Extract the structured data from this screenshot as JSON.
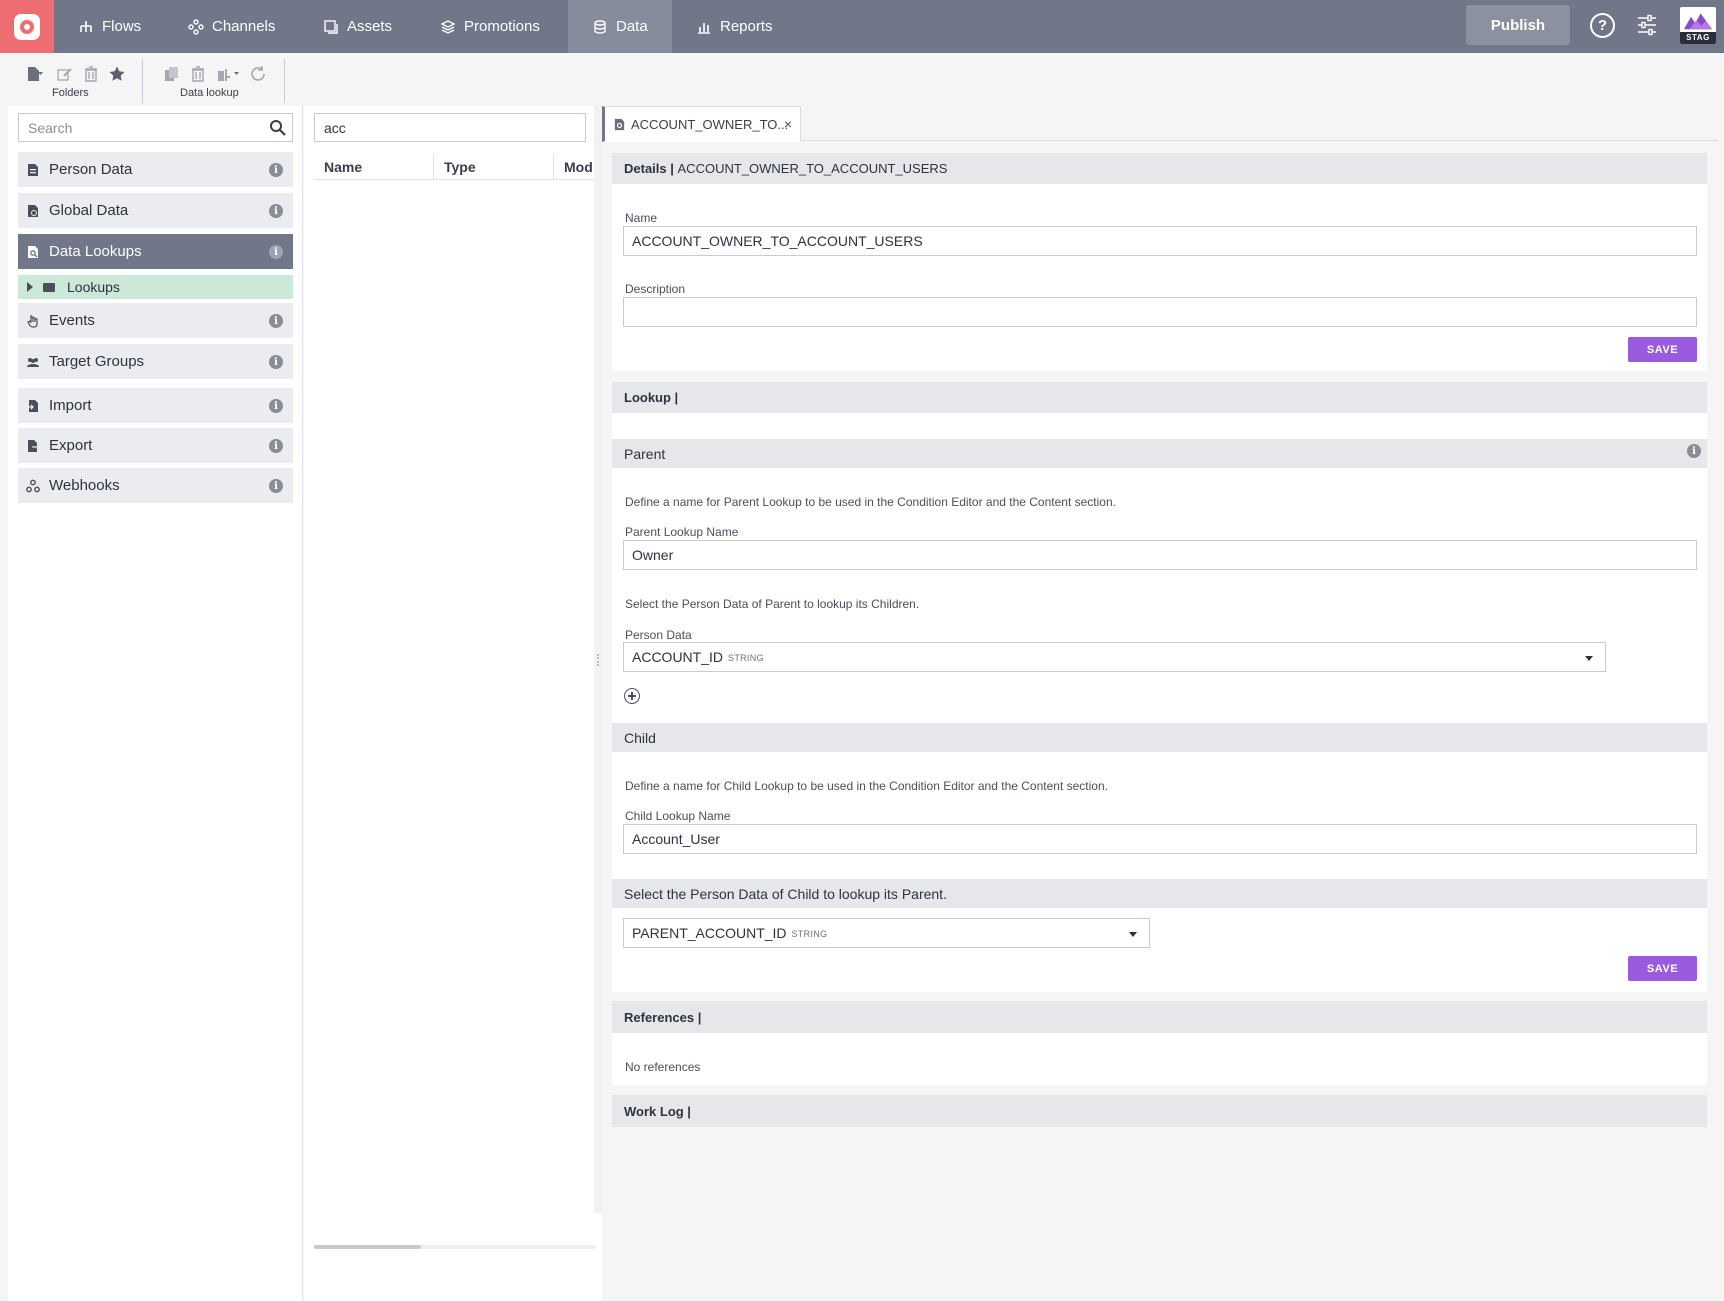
{
  "nav": {
    "items": [
      {
        "label": "Flows",
        "icon": "flows-icon"
      },
      {
        "label": "Channels",
        "icon": "channels-icon"
      },
      {
        "label": "Assets",
        "icon": "assets-icon"
      },
      {
        "label": "Promotions",
        "icon": "promotions-icon"
      },
      {
        "label": "Data",
        "icon": "data-icon",
        "active": true
      },
      {
        "label": "Reports",
        "icon": "reports-icon"
      }
    ],
    "publish_label": "Publish",
    "help_label": "?",
    "env_label": "STAG"
  },
  "toolbar": {
    "folders_label": "Folders",
    "data_lookup_label": "Data lookup"
  },
  "sidebar": {
    "search_placeholder": "Search",
    "items": [
      {
        "label": "Person Data"
      },
      {
        "label": "Global Data"
      },
      {
        "label": "Data Lookups",
        "active": true
      },
      {
        "label": "Events"
      },
      {
        "label": "Target Groups"
      },
      {
        "label": "Import"
      },
      {
        "label": "Export"
      },
      {
        "label": "Webhooks"
      }
    ],
    "subfolder_label": "Lookups",
    "info_glyph": "i"
  },
  "list": {
    "search_value": "acc",
    "columns": [
      "Name",
      "Type",
      "Mod"
    ]
  },
  "tab": {
    "title": "ACCOUNT_OWNER_TO...",
    "close": "×"
  },
  "details": {
    "header_bold": "Details |",
    "header_name": "ACCOUNT_OWNER_TO_ACCOUNT_USERS",
    "name_label": "Name",
    "name_value": "ACCOUNT_OWNER_TO_ACCOUNT_USERS",
    "description_label": "Description",
    "description_value": "",
    "save_label": "SAVE"
  },
  "lookup": {
    "header": "Lookup |",
    "parent": {
      "header": "Parent",
      "hint": "Define a name for Parent Lookup to be used in the Condition Editor and the Content section.",
      "name_label": "Parent Lookup Name",
      "name_value": "Owner",
      "person_hint": "Select the Person Data of Parent to lookup its Children.",
      "person_label": "Person Data",
      "person_value": "ACCOUNT_ID",
      "person_type": "STRING"
    },
    "child": {
      "header": "Child",
      "hint": "Define a name for Child Lookup to be used in the Condition Editor and the Content section.",
      "name_label": "Child Lookup Name",
      "name_value": "Account_User",
      "person_header": "Select the Person Data of Child to lookup its Parent.",
      "person_value": "PARENT_ACCOUNT_ID",
      "person_type": "STRING"
    },
    "save_label": "SAVE"
  },
  "references": {
    "header": "References |",
    "empty": "No references"
  },
  "worklog": {
    "header": "Work Log |"
  }
}
